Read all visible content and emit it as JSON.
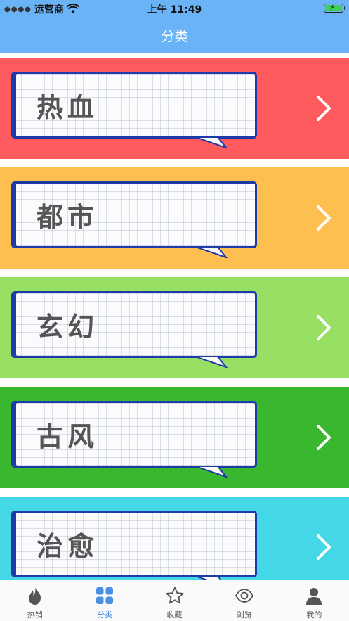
{
  "status_bar": {
    "carrier": "运营商",
    "time": "上午 11:49",
    "signal_icon": "signal-dots-icon",
    "wifi_icon": "wifi-icon",
    "battery_icon": "battery-charging-icon"
  },
  "header": {
    "title": "分类"
  },
  "categories": [
    {
      "label": "热血",
      "color": "#fd5b5d"
    },
    {
      "label": "都市",
      "color": "#fdbf4f"
    },
    {
      "label": "玄幻",
      "color": "#98e063"
    },
    {
      "label": "古风",
      "color": "#38b72f"
    },
    {
      "label": "治愈",
      "color": "#44d8e6"
    }
  ],
  "tab_bar": {
    "items": [
      {
        "label": "热销",
        "icon": "flame-icon"
      },
      {
        "label": "分类",
        "icon": "grid-icon",
        "active": true
      },
      {
        "label": "收藏",
        "icon": "star-icon"
      },
      {
        "label": "浏览",
        "icon": "eye-icon"
      },
      {
        "label": "我的",
        "icon": "user-icon"
      }
    ],
    "active_color": "#4a90e2",
    "inactive_color": "#555555"
  }
}
